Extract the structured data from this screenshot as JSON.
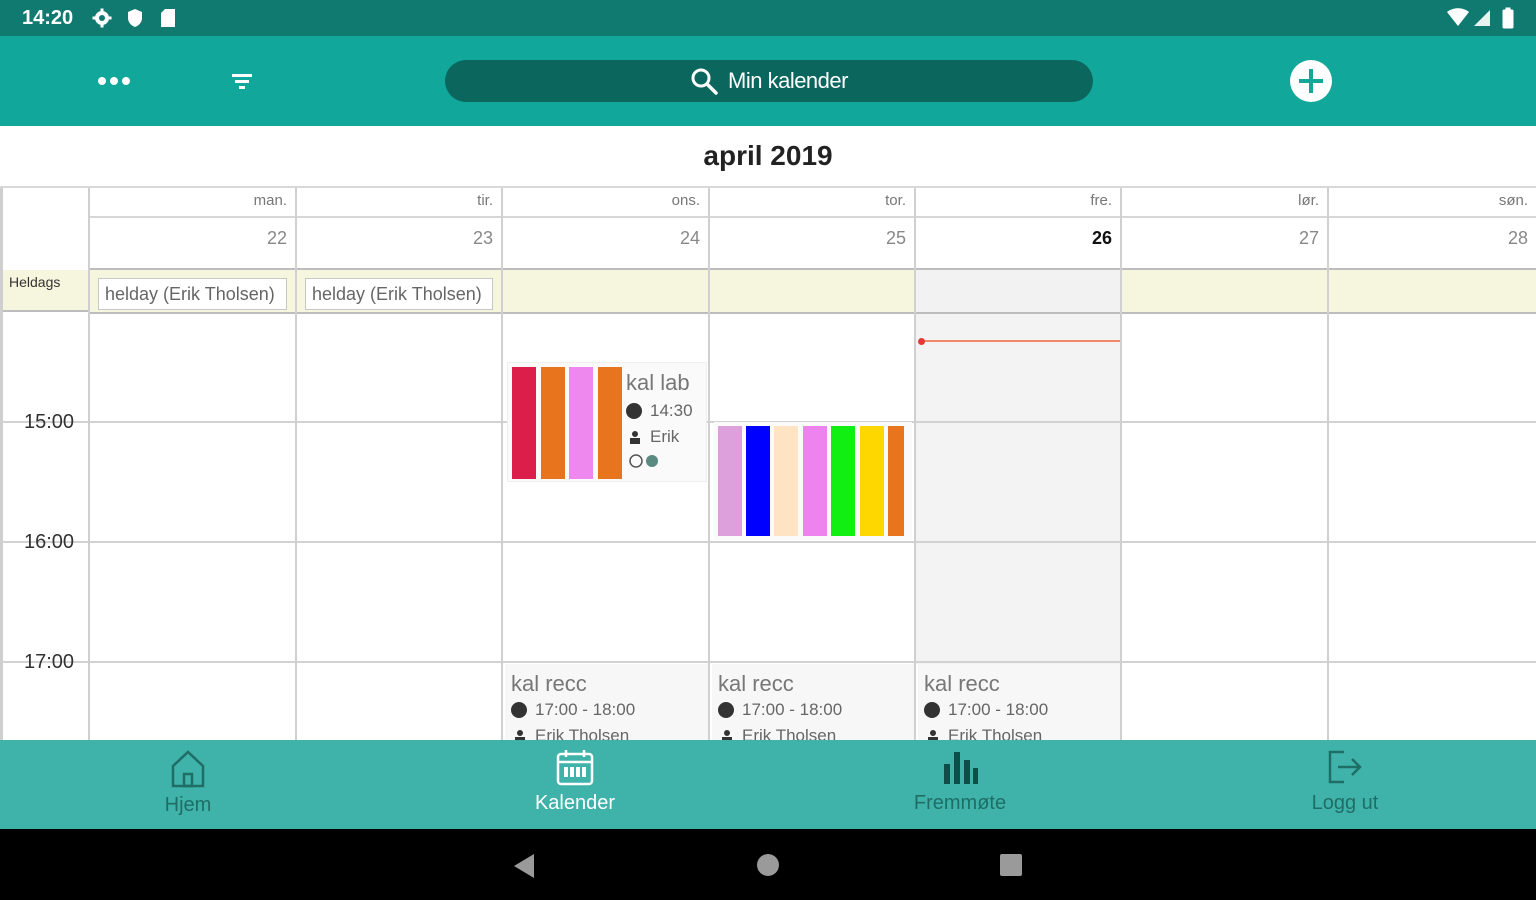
{
  "status": {
    "time": "14:20"
  },
  "toolbar": {
    "menu_icon": "more-dots-icon",
    "filter_icon": "filter-icon",
    "search_label": "Min kalender",
    "add_icon": "plus-circle-icon"
  },
  "calendar": {
    "month_title": "april 2019",
    "allday_label": "Heldags",
    "hours": [
      "15:00",
      "16:00",
      "17:00"
    ],
    "days": [
      {
        "name": "man.",
        "num": "22",
        "allday": "helday (Erik  Tholsen)"
      },
      {
        "name": "tir.",
        "num": "23",
        "allday": "helday (Erik  Tholsen)"
      },
      {
        "name": "ons.",
        "num": "24",
        "allday": ""
      },
      {
        "name": "tor.",
        "num": "25",
        "allday": ""
      },
      {
        "name": "fre.",
        "num": "26",
        "allday": ""
      },
      {
        "name": "lør.",
        "num": "27",
        "allday": ""
      },
      {
        "name": "søn.",
        "num": "28",
        "allday": ""
      }
    ],
    "today_index": 4,
    "event_kal_lab": {
      "title": "kal lab",
      "time": "14:30",
      "person": "Erik",
      "colors": [
        "#dc1e4b",
        "#e8741e",
        "#ee88ee",
        "#e8741e"
      ]
    },
    "event_bars_thu": {
      "colors": [
        "#dda0dd",
        "#0000ff",
        "#ffe4c4",
        "#ee82ee",
        "#11ee11",
        "#ffd700",
        "#e8741e"
      ]
    },
    "recurring": {
      "title": "kal recc",
      "time": "17:00 - 18:00",
      "person": "Erik  Tholsen"
    }
  },
  "bottomnav": {
    "items": [
      {
        "label": "Hjem",
        "icon": "home-icon"
      },
      {
        "label": "Kalender",
        "icon": "calendar-icon"
      },
      {
        "label": "Fremmøte",
        "icon": "bar-chart-icon"
      },
      {
        "label": "Logg ut",
        "icon": "logout-icon"
      }
    ]
  },
  "colors": {
    "primary": "#12a79b",
    "primary_dark": "#117a70",
    "nav_bg": "#3fb3aa",
    "allday_bg": "#f6f5dd"
  }
}
